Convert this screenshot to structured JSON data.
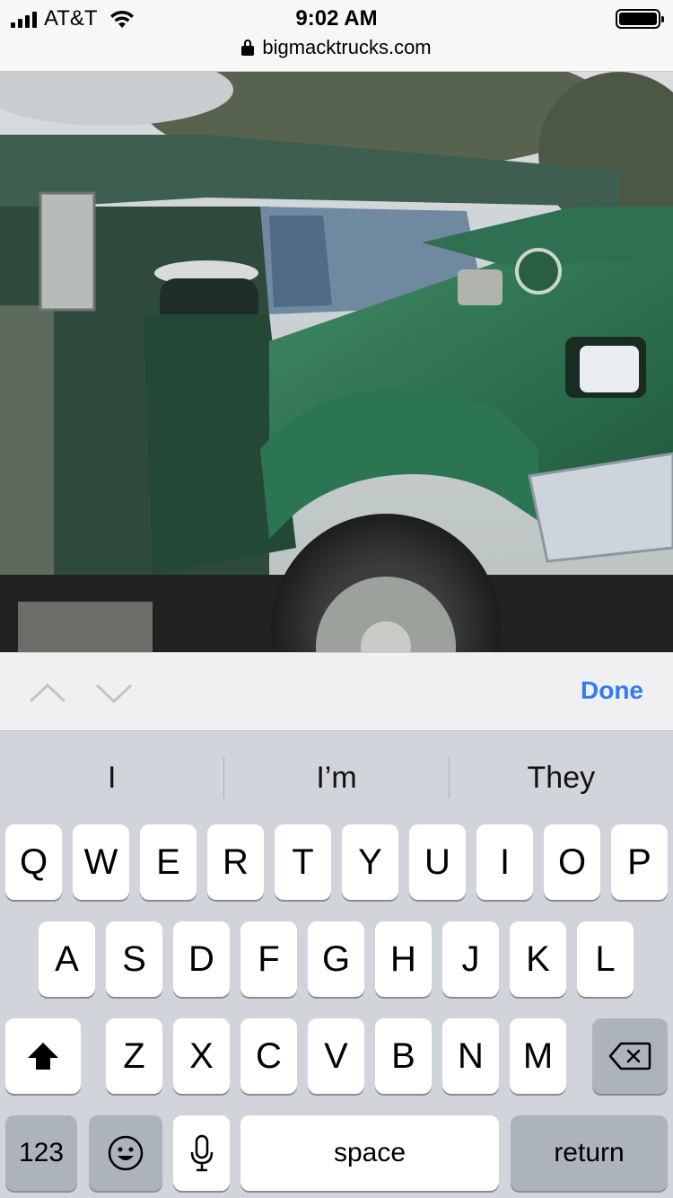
{
  "status_bar": {
    "carrier": "AT&T",
    "time": "9:02 AM",
    "url": "bigmacktrucks.com"
  },
  "content": {
    "image_icon": "photo-green-mack-truck"
  },
  "accessory_bar": {
    "done_label": "Done"
  },
  "keyboard": {
    "suggestions": [
      "I",
      "I’m",
      "They"
    ],
    "row1": [
      "Q",
      "W",
      "E",
      "R",
      "T",
      "Y",
      "U",
      "I",
      "O",
      "P"
    ],
    "row2": [
      "A",
      "S",
      "D",
      "F",
      "G",
      "H",
      "J",
      "K",
      "L"
    ],
    "row3": [
      "Z",
      "X",
      "C",
      "V",
      "B",
      "N",
      "M"
    ],
    "numbers_label": "123",
    "space_label": "space",
    "return_label": "return"
  },
  "colors": {
    "accent": "#2f7cf6",
    "keyboard_bg": "#d1d4da",
    "key_dark": "#adb3bc"
  }
}
